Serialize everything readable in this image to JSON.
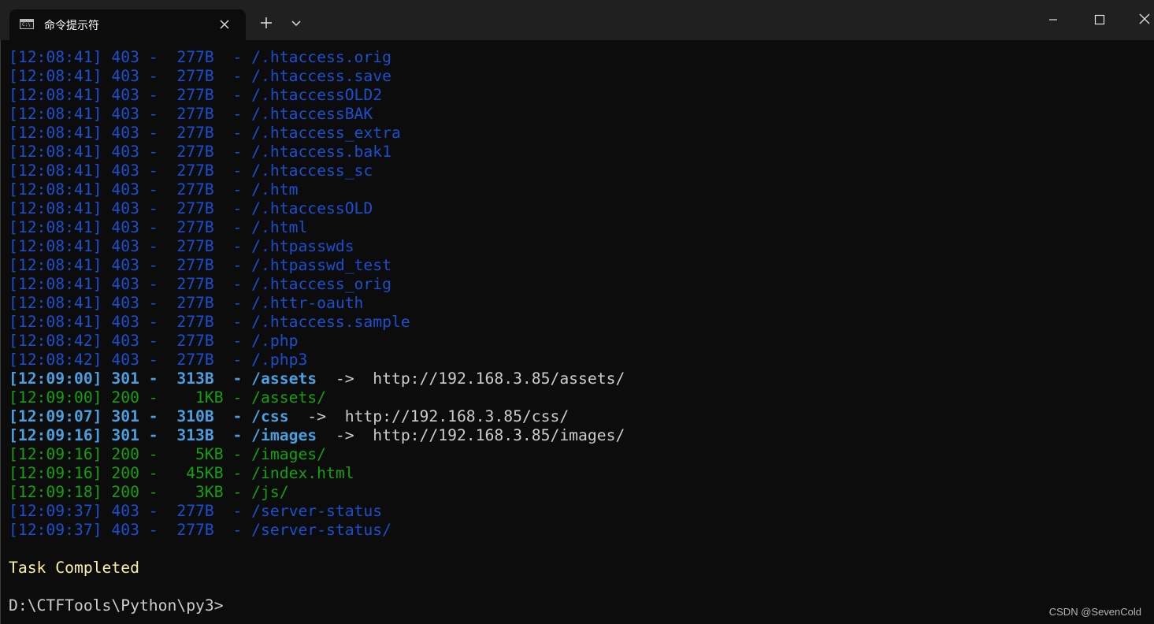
{
  "window": {
    "tab_title": "命令提示符",
    "buttons": {
      "new_tab": "new-tab",
      "dropdown": "tab-dropdown",
      "minimize": "minimize",
      "maximize": "maximize",
      "close": "close"
    }
  },
  "terminal": {
    "colors": {
      "forbidden": "#1a4fd0",
      "redirect": "#4a9fe0",
      "ok": "#13a10e",
      "default": "#cccccc",
      "completed": "#f9f1a5"
    },
    "lines": [
      {
        "kind": "403",
        "text": "[12:08:41] 403 -  277B  - /.htaccess.orig"
      },
      {
        "kind": "403",
        "text": "[12:08:41] 403 -  277B  - /.htaccess.save"
      },
      {
        "kind": "403",
        "text": "[12:08:41] 403 -  277B  - /.htaccessOLD2"
      },
      {
        "kind": "403",
        "text": "[12:08:41] 403 -  277B  - /.htaccessBAK"
      },
      {
        "kind": "403",
        "text": "[12:08:41] 403 -  277B  - /.htaccess_extra"
      },
      {
        "kind": "403",
        "text": "[12:08:41] 403 -  277B  - /.htaccess.bak1"
      },
      {
        "kind": "403",
        "text": "[12:08:41] 403 -  277B  - /.htaccess_sc"
      },
      {
        "kind": "403",
        "text": "[12:08:41] 403 -  277B  - /.htm"
      },
      {
        "kind": "403",
        "text": "[12:08:41] 403 -  277B  - /.htaccessOLD"
      },
      {
        "kind": "403",
        "text": "[12:08:41] 403 -  277B  - /.html"
      },
      {
        "kind": "403",
        "text": "[12:08:41] 403 -  277B  - /.htpasswds"
      },
      {
        "kind": "403",
        "text": "[12:08:41] 403 -  277B  - /.htpasswd_test"
      },
      {
        "kind": "403",
        "text": "[12:08:41] 403 -  277B  - /.htaccess_orig"
      },
      {
        "kind": "403",
        "text": "[12:08:41] 403 -  277B  - /.httr-oauth"
      },
      {
        "kind": "403",
        "text": "[12:08:41] 403 -  277B  - /.htaccess.sample"
      },
      {
        "kind": "403",
        "text": "[12:08:42] 403 -  277B  - /.php"
      },
      {
        "kind": "403",
        "text": "[12:08:42] 403 -  277B  - /.php3"
      },
      {
        "kind": "301",
        "text": "[12:09:00] 301 -  313B  - /assets",
        "redirect": "  ->  http://192.168.3.85/assets/"
      },
      {
        "kind": "200",
        "text": "[12:09:00] 200 -    1KB - /assets/"
      },
      {
        "kind": "301",
        "text": "[12:09:07] 301 -  310B  - /css",
        "redirect": "  ->  http://192.168.3.85/css/"
      },
      {
        "kind": "301",
        "text": "[12:09:16] 301 -  313B  - /images",
        "redirect": "  ->  http://192.168.3.85/images/"
      },
      {
        "kind": "200",
        "text": "[12:09:16] 200 -    5KB - /images/"
      },
      {
        "kind": "200",
        "text": "[12:09:16] 200 -   45KB - /index.html"
      },
      {
        "kind": "200",
        "text": "[12:09:18] 200 -    3KB - /js/"
      },
      {
        "kind": "403",
        "text": "[12:09:37] 403 -  277B  - /server-status"
      },
      {
        "kind": "403",
        "text": "[12:09:37] 403 -  277B  - /server-status/"
      }
    ],
    "completed": "Task Completed",
    "prompt": "D:\\CTFTools\\Python\\py3>"
  },
  "watermark": "CSDN @SevenCold"
}
